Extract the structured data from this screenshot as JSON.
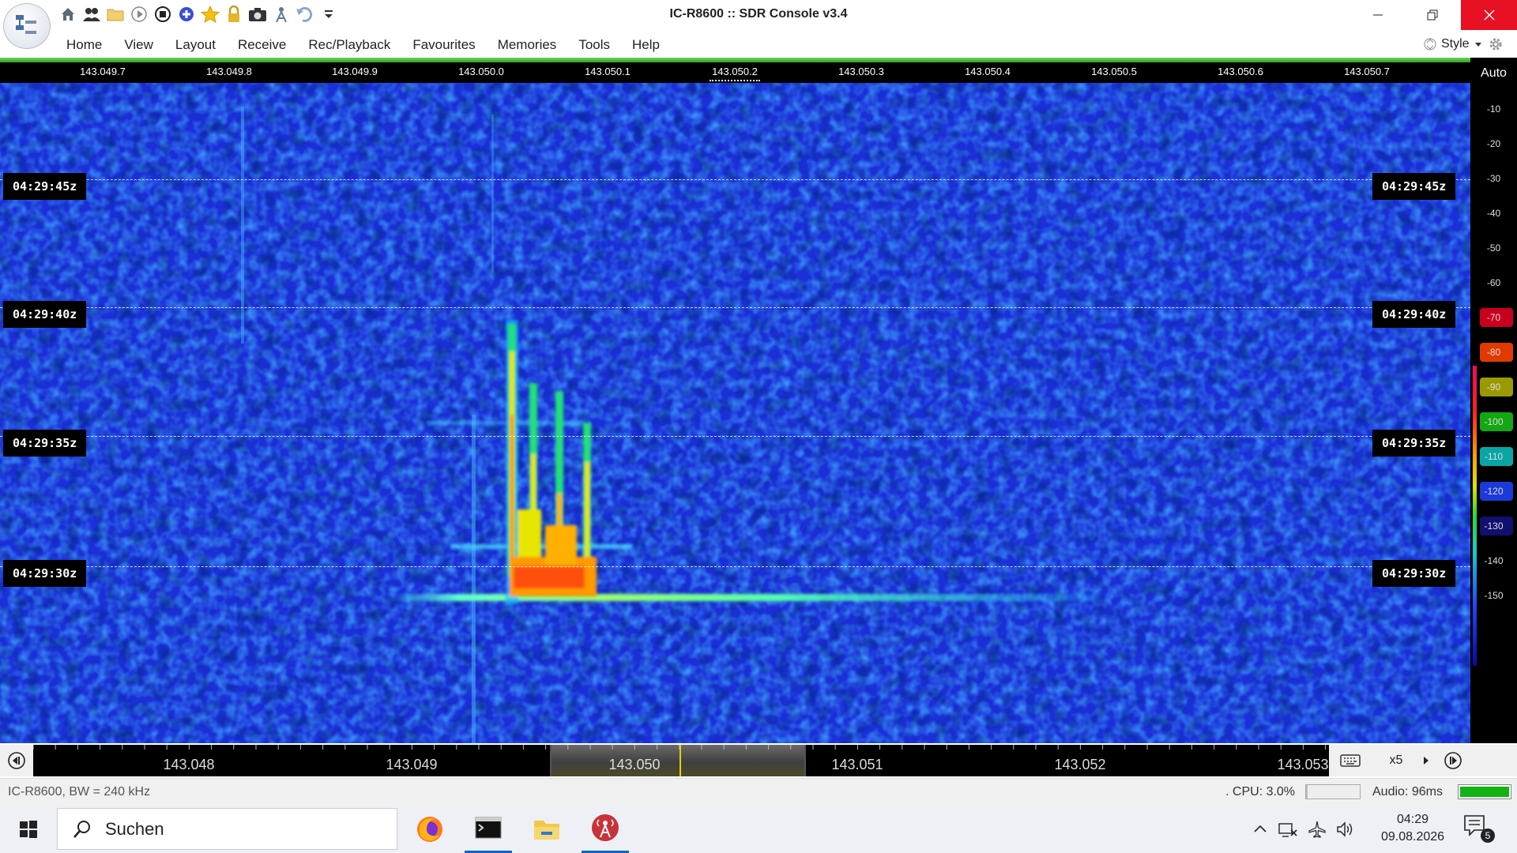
{
  "window": {
    "title": "IC-R8600 :: SDR Console v3.4",
    "minimize_icon": "minimize-icon",
    "restore_icon": "restore-icon",
    "close_icon": "close-icon"
  },
  "quick_access": [
    {
      "name": "home-icon"
    },
    {
      "name": "users-icon"
    },
    {
      "name": "folder-icon"
    },
    {
      "name": "play-icon"
    },
    {
      "name": "stop-icon"
    },
    {
      "name": "plus-icon"
    },
    {
      "name": "star-icon"
    },
    {
      "name": "lock-icon"
    },
    {
      "name": "camera-icon"
    },
    {
      "name": "antenna-icon"
    },
    {
      "name": "undo-icon"
    },
    {
      "name": "dropdown-icon"
    }
  ],
  "menu": {
    "items": [
      "Home",
      "View",
      "Layout",
      "Receive",
      "Rec/Playback",
      "Favourites",
      "Memories",
      "Tools",
      "Help"
    ],
    "style_label": "Style"
  },
  "freq_header": {
    "ticks": [
      "143.049.7",
      "143.049.8",
      "143.049.9",
      "143.050.0",
      "143.050.1",
      "143.050.2",
      "143.050.3",
      "143.050.4",
      "143.050.5",
      "143.050.6",
      "143.050.7"
    ],
    "auto_label": "Auto"
  },
  "waterfall": {
    "time_labels": [
      "04:29:45z",
      "04:29:40z",
      "04:29:35z",
      "04:29:30z"
    ]
  },
  "db_scale": {
    "ticks": [
      "-10",
      "-20",
      "-30",
      "-40",
      "-50",
      "-60",
      "-70",
      "-80",
      "-90",
      "-100",
      "-110",
      "-120",
      "-130",
      "-140",
      "-150"
    ],
    "highlight_colors": {
      "-70": "#c8001e",
      "-80": "#e03a00",
      "-90": "#9a9a00",
      "-100": "#13a713",
      "-110": "#0aa6a6",
      "-120": "#1a3ad9",
      "-130": "#101070"
    }
  },
  "bottom_scale": {
    "labels": [
      "143.048",
      "143.049",
      "143.050",
      "143.051",
      "143.052",
      "143.053"
    ],
    "zoom_label": "x5"
  },
  "status": {
    "device": "IC-R8600, BW = 240 kHz",
    "cpu": ". CPU: 3.0%",
    "cpu_level": 0.03,
    "audio": "Audio: 96ms",
    "audio_level": 1.0
  },
  "taskbar": {
    "search_placeholder": "Suchen",
    "apps": [
      "firefox-icon",
      "terminal-icon",
      "file-explorer-icon",
      "sdr-console-icon"
    ],
    "tray_icons": [
      "chevron-up-icon",
      "network-icon",
      "airplane-icon",
      "speaker-icon"
    ],
    "time": "04:29",
    "date": "09.08.2026",
    "notification_count": "5"
  },
  "colors": {
    "accent_green": "#2aa323",
    "close_red": "#e81123",
    "cursor_yellow": "#e6d100",
    "waterfall_blue": "#1a2fd6"
  }
}
